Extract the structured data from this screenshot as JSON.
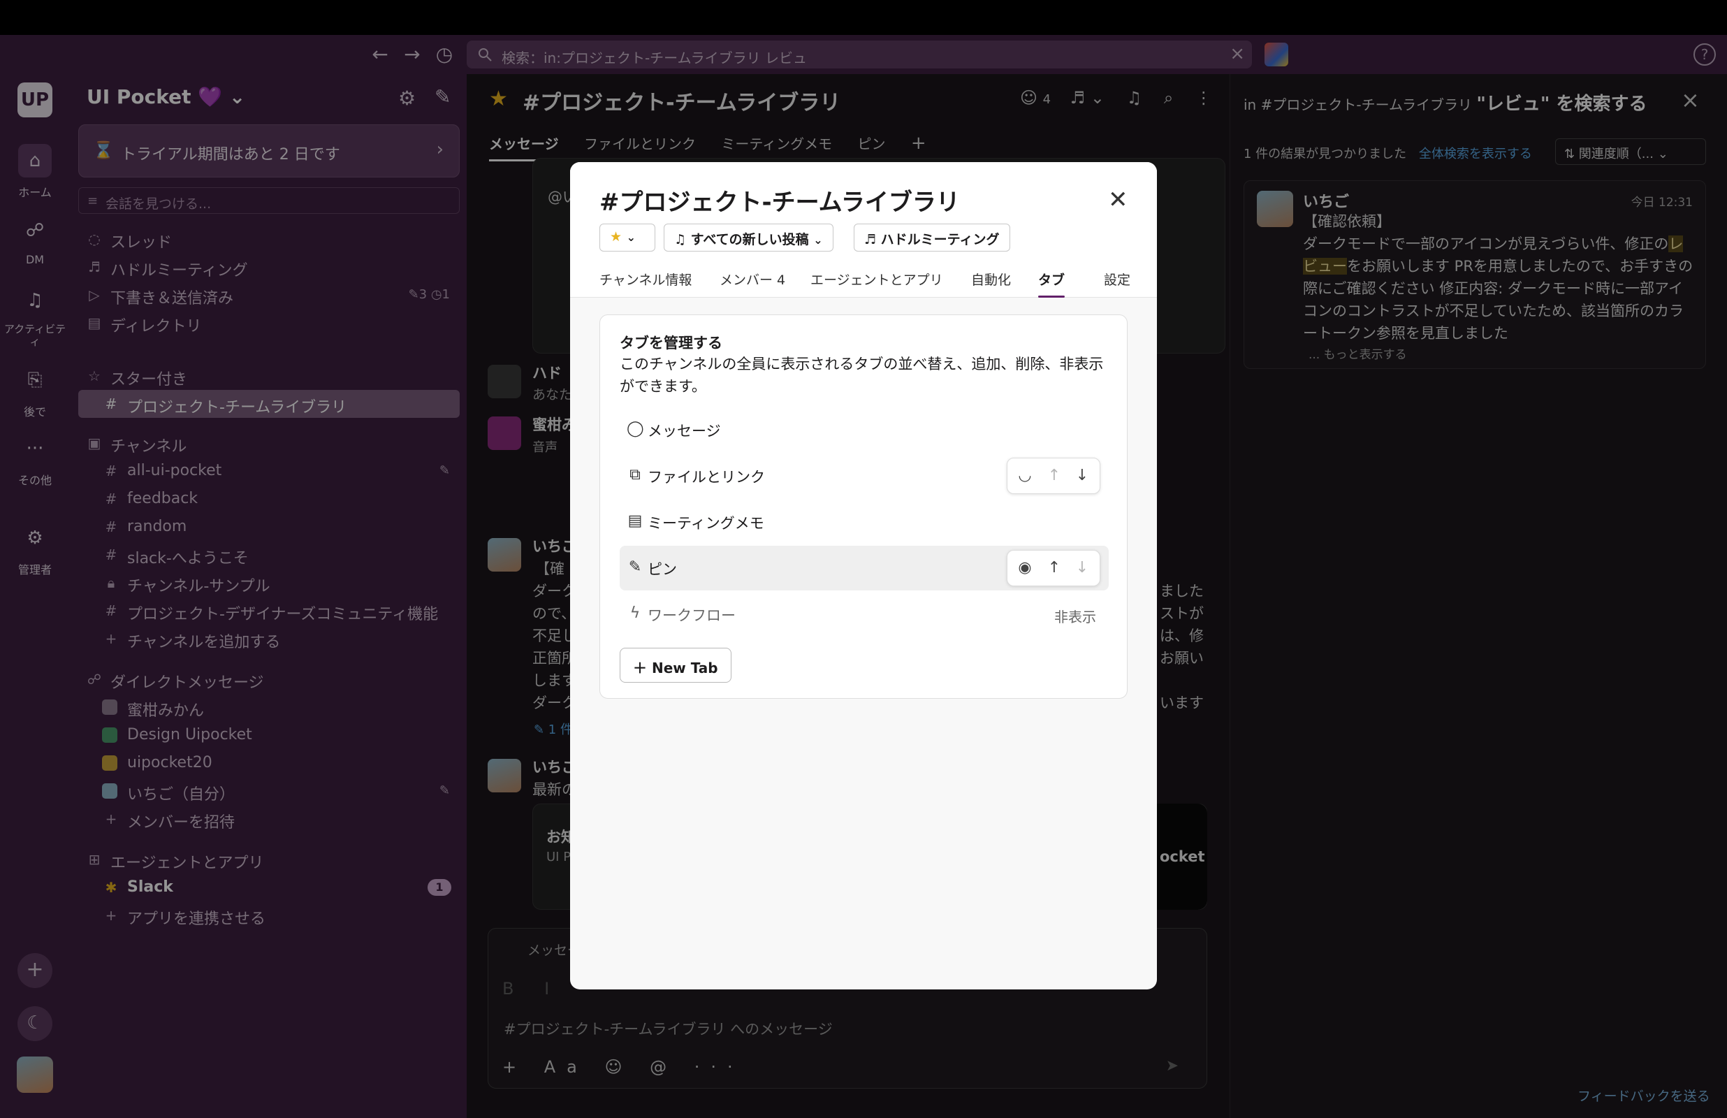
{
  "search": {
    "placeholder": "検索：in:プロジェクト-チームライブラリ レビュ"
  },
  "nav": {
    "back": "←",
    "forward": "→",
    "history": "◷"
  },
  "rail": {
    "workspace_initials": "UP",
    "items": [
      {
        "label": "ホーム"
      },
      {
        "label": "DM"
      },
      {
        "label": "アクティビティ"
      },
      {
        "label": "後で"
      },
      {
        "label": "その他"
      },
      {
        "label": "管理者"
      }
    ]
  },
  "sidebar": {
    "workspace": "UI Pocket 💜 ⌄",
    "trial": "トライアル期間はあと 2 日です",
    "find": "会話を見つける...",
    "nav": [
      {
        "label": "スレッド"
      },
      {
        "label": "ハドルミーティング"
      },
      {
        "label": "下書き＆送信済み",
        "meta": "✎3 ◷1"
      },
      {
        "label": "ディレクトリ"
      }
    ],
    "starred_header": "スター付き",
    "starred": [
      {
        "label": "プロジェクト-チームライブラリ"
      }
    ],
    "channels_header": "チャンネル",
    "channels": [
      {
        "label": "all-ui-pocket"
      },
      {
        "label": "feedback"
      },
      {
        "label": "random"
      },
      {
        "label": "slack-へようこそ"
      },
      {
        "label": "チャンネル-サンプル"
      },
      {
        "label": "プロジェクト-デザイナーズコミュニティ機能"
      },
      {
        "label": "チャンネルを追加する"
      }
    ],
    "dm_header": "ダイレクトメッセージ",
    "dms": [
      {
        "label": "蜜柑みかん"
      },
      {
        "label": "Design Uipocket"
      },
      {
        "label": "uipocket20"
      },
      {
        "label": "いちご（自分）"
      },
      {
        "label": "メンバーを招待"
      }
    ],
    "apps_header": "エージェントとアプリ",
    "apps": [
      {
        "label": "Slack",
        "badge": "1"
      },
      {
        "label": "アプリを連携させる"
      }
    ]
  },
  "channel": {
    "name": "#プロジェクト-チームライブラリ",
    "member_count": "4",
    "tabs": [
      "メッセージ",
      "ファイルとリンク",
      "ミーティングメモ",
      "ピン"
    ],
    "add_tab": "+",
    "fragments": {
      "f1": "@い",
      "f2": "ハド",
      "f3": "あなた",
      "f4": "蜜柑み",
      "f5": "音声",
      "f6": "いちご",
      "f7": "【確",
      "f8": "ダーク",
      "f9": "ので、",
      "f10": "不足し",
      "f11": "正箇所",
      "f12": "します",
      "f13": "ダーク",
      "f14": "✎ 1 件",
      "f15": "いちご",
      "f16": "最新の",
      "f17": "お知",
      "f18": "UI P",
      "r1": "ました",
      "r2": "ストが",
      "r3": "は、修",
      "r4": "お願い",
      "r5": "います",
      "r6": "ocket",
      "c1": "メッセー"
    },
    "composer_placeholder": "#プロジェクト-チームライブラリ へのメッセージ",
    "composer_tools": "+ Aa ☺ @ ···"
  },
  "right_panel": {
    "title_prefix": "in #プロジェクト-チームライブラリ",
    "title_query": "\"レビュ\" を検索する",
    "result_count": "1 件の結果が見つかりました",
    "show_all": "全体検索を表示する",
    "sort": "⇅ 関連度順（...  ⌄",
    "result": {
      "author": "いちご",
      "time": "今日 12:31",
      "line1": "【確認依頼】",
      "line2a": "ダークモードで一部のアイコンが見えづらい件、修正の",
      "highlight": "レビュー",
      "line2b": "をお願いします PRを用意しましたので、お手すきの際にご確認ください 修正内容: ダークモード時に一部アイコンのコントラストが不足していたため、該当箇所のカラートークン参照を見直しました",
      "more": "... もっと表示する"
    },
    "feedback": "フィードバックを送る"
  },
  "modal": {
    "title": "#プロジェクト-チームライブラリ",
    "notify_label": "すべての新しい投稿",
    "huddle_label": "ハドルミーティング",
    "tabs": [
      "チャンネル情報",
      "メンバー 4",
      "エージェントとアプリ",
      "自動化",
      "タブ",
      "設定"
    ],
    "panel_title": "タブを管理する",
    "panel_desc": "このチャンネルの全員に表示されるタブの並べ替え、追加、削除、非表示ができます。",
    "tab_items": [
      {
        "label": "メッセージ",
        "icon": "message-icon"
      },
      {
        "label": "ファイルとリンク",
        "icon": "files-icon"
      },
      {
        "label": "ミーティングメモ",
        "icon": "notes-icon"
      },
      {
        "label": "ピン",
        "icon": "pin-icon"
      },
      {
        "label": "ワークフロー",
        "icon": "workflow-icon",
        "status": "非表示"
      }
    ],
    "new_tab": "New Tab"
  }
}
